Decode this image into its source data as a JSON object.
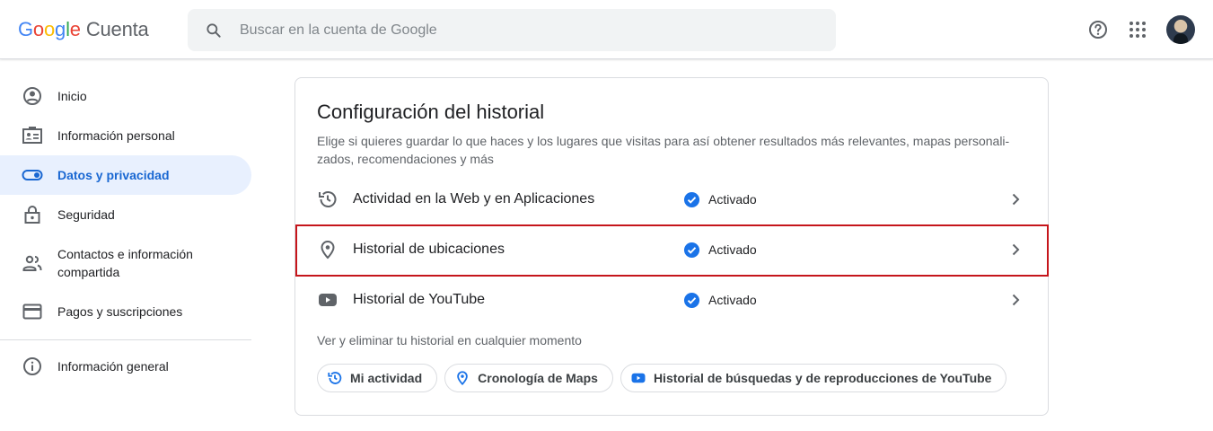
{
  "header": {
    "logo_google": "Google",
    "logo_product": "Cuenta",
    "search_placeholder": "Buscar en la cuenta de Google",
    "icons": [
      "search-icon",
      "help-icon",
      "apps-grid-icon",
      "avatar"
    ]
  },
  "sidebar": {
    "items": [
      {
        "label": "Inicio",
        "icon": "account-circle-icon",
        "active": false
      },
      {
        "label": "Información personal",
        "icon": "id-card-icon",
        "active": false
      },
      {
        "label": "Datos y privacidad",
        "icon": "toggle-icon",
        "active": true
      },
      {
        "label": "Seguridad",
        "icon": "lock-icon",
        "active": false
      },
      {
        "label": "Contactos e información compartida",
        "icon": "people-icon",
        "active": false
      },
      {
        "label": "Pagos y suscripciones",
        "icon": "credit-card-icon",
        "active": false
      }
    ],
    "general": {
      "label": "Información general",
      "icon": "info-icon"
    }
  },
  "card": {
    "title": "Configuración del historial",
    "description": "Elige si quieres guardar lo que haces y los lugares que visitas para así obtener resultados más relevantes, mapas personali-zados, recomendaciones y más",
    "rows": [
      {
        "label": "Actividad en la Web y en Aplicaciones",
        "status": "Activado",
        "icon": "history-icon"
      },
      {
        "label": "Historial de ubicaciones",
        "status": "Activado",
        "icon": "location-pin-icon",
        "highlighted": true
      },
      {
        "label": "Historial de YouTube",
        "status": "Activado",
        "icon": "youtube-icon"
      }
    ],
    "subheading": "Ver y eliminar tu historial en cualquier momento",
    "chips": [
      {
        "label": "Mi actividad",
        "icon": "history-icon"
      },
      {
        "label": "Cronología de Maps",
        "icon": "location-pin-icon"
      },
      {
        "label": "Historial de búsquedas y de reproducciones de YouTube",
        "icon": "youtube-icon"
      }
    ]
  },
  "colors": {
    "accent": "#1a73e8",
    "active_nav_bg": "#e8f0fe",
    "active_nav_text": "#1967d2",
    "highlight_border": "#c5151b"
  }
}
